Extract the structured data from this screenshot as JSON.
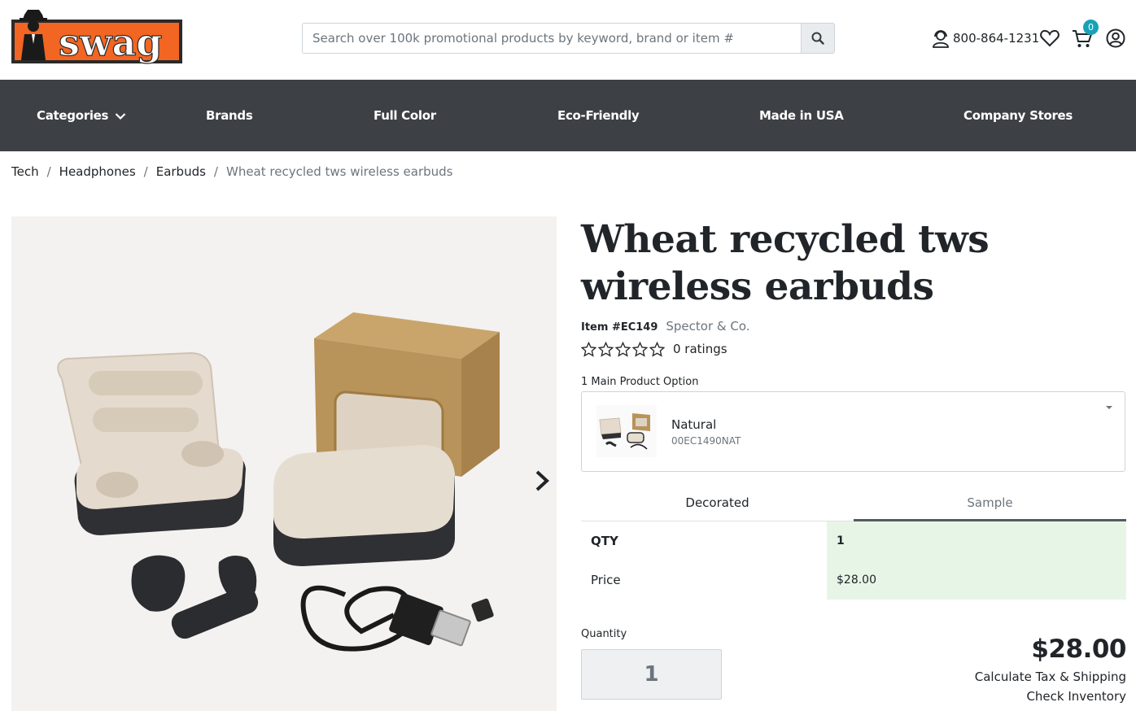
{
  "header": {
    "logo_text": "swag",
    "search": {
      "placeholder": "Search over 100k promotional products by keyword, brand or item #"
    },
    "phone": "800-864-1231",
    "cart_count": "0",
    "colors": {
      "logo_orange": "#f26522",
      "nav_bg": "#3d4044",
      "badge": "#17a2b8"
    }
  },
  "nav": {
    "items": [
      {
        "label": "Categories"
      },
      {
        "label": "Brands"
      },
      {
        "label": "Full Color"
      },
      {
        "label": "Eco-Friendly"
      },
      {
        "label": "Made in USA"
      },
      {
        "label": "Company Stores"
      }
    ]
  },
  "breadcrumb": {
    "items": [
      "Tech",
      "Headphones",
      "Earbuds"
    ],
    "current": "Wheat recycled tws wireless earbuds"
  },
  "product": {
    "title_line1": "Wheat recycled tws",
    "title_line2": "wireless earbuds",
    "item_number": "Item #EC149",
    "brand": "Spector & Co.",
    "rating_stars": 0,
    "ratings_text": "0 ratings",
    "option_label": "1 Main Product Option",
    "option": {
      "name": "Natural",
      "code": "00EC1490NAT"
    },
    "tabs": [
      {
        "label": "Decorated"
      },
      {
        "label": "Sample"
      }
    ],
    "active_tab": "Sample",
    "table": {
      "qty_label": "QTY",
      "qty_value": "1",
      "price_label": "Price",
      "price_value": "$28.00"
    },
    "quantity_label": "Quantity",
    "quantity_value": "1",
    "total": "$28.00",
    "calc_link": "Calculate Tax & Shipping",
    "inventory_link": "Check Inventory"
  }
}
